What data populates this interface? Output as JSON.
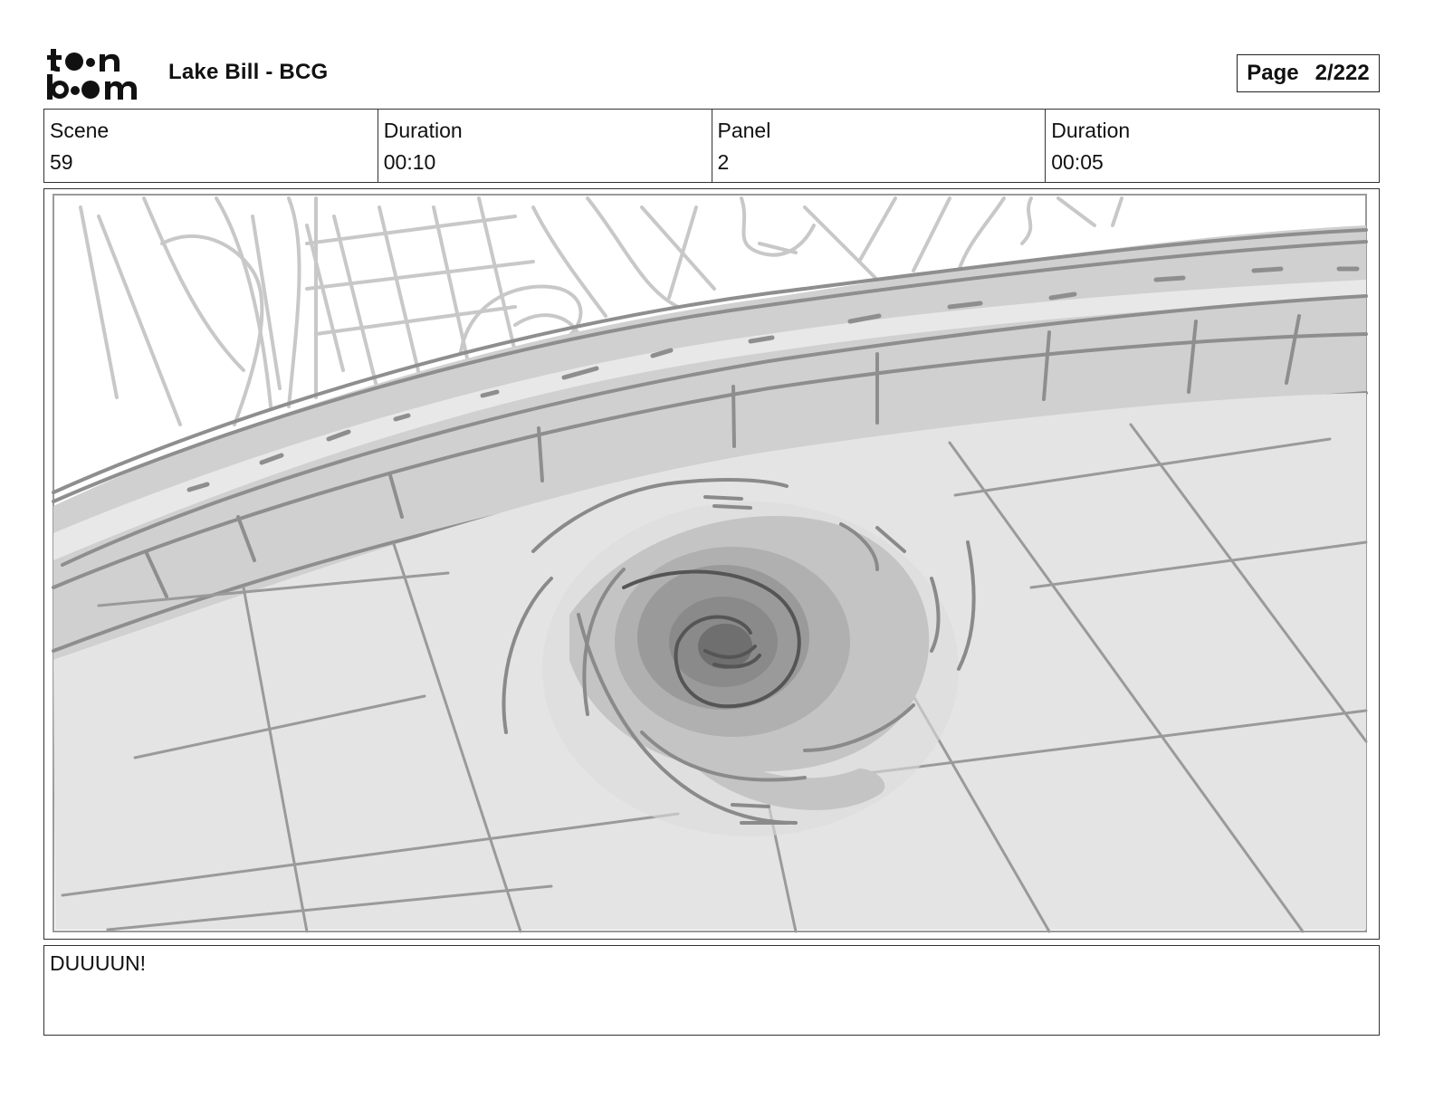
{
  "header": {
    "logo_text": "toonboom",
    "project_title": "Lake Bill - BCG",
    "page_label": "Page",
    "page_value": "2/222"
  },
  "info": {
    "scene_label": "Scene",
    "scene_value": "59",
    "scene_duration_label": "Duration",
    "scene_duration_value": "00:10",
    "panel_label": "Panel",
    "panel_value": "2",
    "panel_duration_label": "Duration",
    "panel_duration_value": "00:05"
  },
  "panel": {
    "image_description_icon": "storyboard-sketch-whirlpool-icon"
  },
  "dialogue": {
    "text": "DUUUUN!"
  },
  "colors": {
    "ink": "#111111",
    "border": "#333333",
    "sketch_light": "#c8c8c8",
    "sketch_mid": "#9a9a9a",
    "sketch_dark": "#555555",
    "floor": "#e4e4e4",
    "ledge": "#d0d0d0"
  }
}
